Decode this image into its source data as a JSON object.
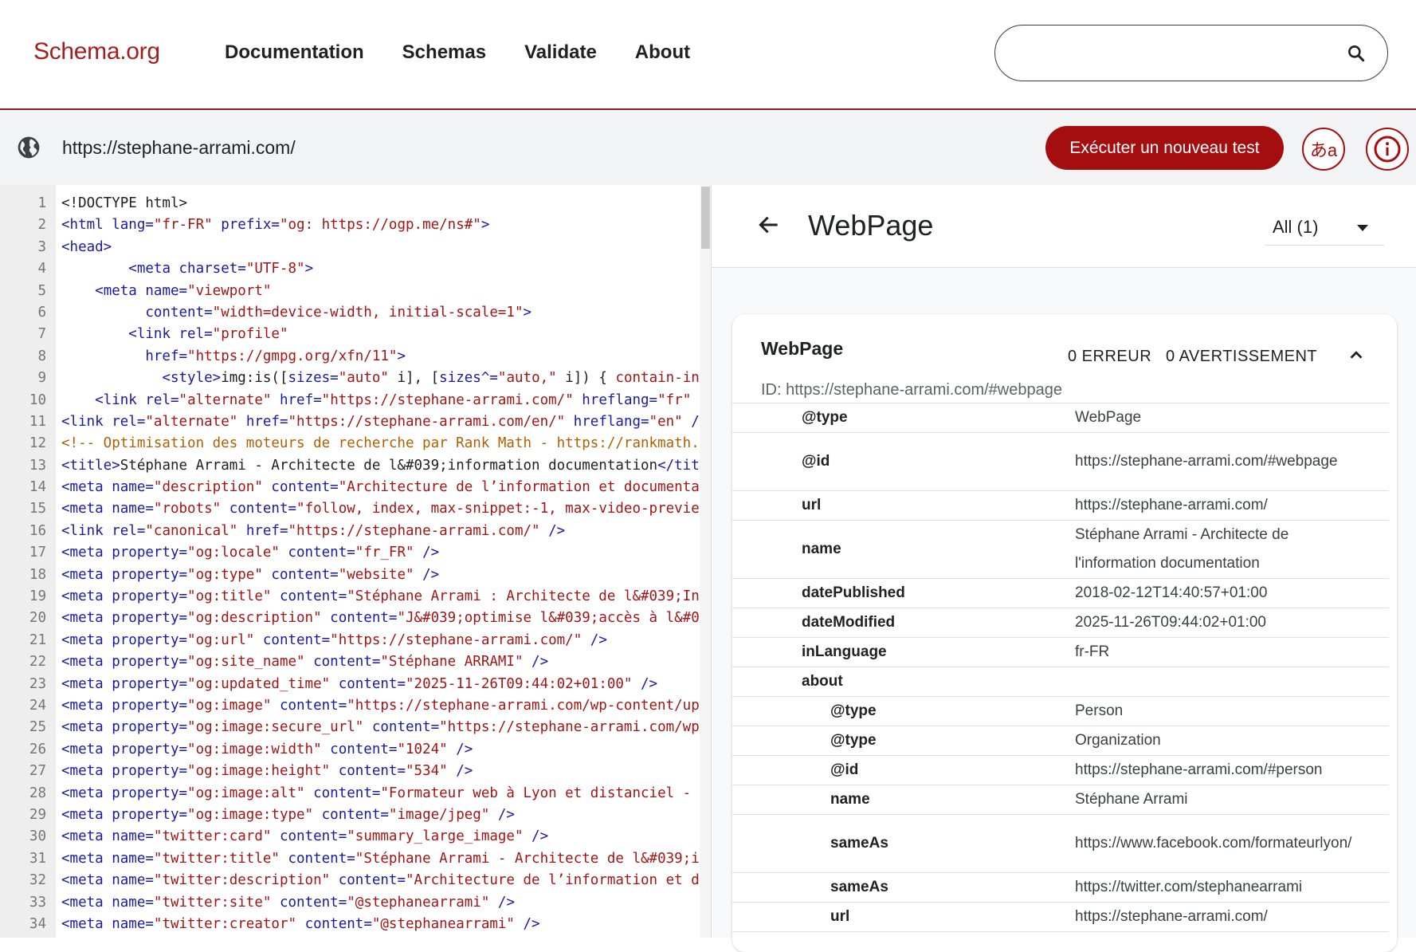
{
  "header": {
    "logo": "Schema.org",
    "nav": [
      "Documentation",
      "Schemas",
      "Validate",
      "About"
    ],
    "search_value": ""
  },
  "urlbar": {
    "url": "https://stephane-arrami.com/",
    "run_label": "Exécuter un nouveau test",
    "lang_label": "あa",
    "info_label": "i"
  },
  "code_lines": [
    [
      [
        "",
        "<!DOCTYPE html>"
      ]
    ],
    [
      [
        "t",
        "<html "
      ],
      [
        "a",
        "lang="
      ],
      [
        "v",
        "\"fr-FR\""
      ],
      [
        "a",
        " prefix="
      ],
      [
        "v",
        "\"og: https://ogp.me/ns#\""
      ],
      [
        "t",
        ">"
      ]
    ],
    [
      [
        "t",
        "<head>"
      ]
    ],
    [
      [
        "",
        "        "
      ],
      [
        "t",
        "<meta "
      ],
      [
        "a",
        "charset="
      ],
      [
        "v",
        "\"UTF-8\""
      ],
      [
        "t",
        ">"
      ]
    ],
    [
      [
        "",
        "    "
      ],
      [
        "t",
        "<meta "
      ],
      [
        "a",
        "name="
      ],
      [
        "v",
        "\"viewport\""
      ]
    ],
    [
      [
        "",
        "          "
      ],
      [
        "a",
        "content="
      ],
      [
        "v",
        "\"width=device-width, initial-scale=1\""
      ],
      [
        "t",
        ">"
      ]
    ],
    [
      [
        "",
        "        "
      ],
      [
        "t",
        "<link "
      ],
      [
        "a",
        "rel="
      ],
      [
        "v",
        "\"profile\""
      ]
    ],
    [
      [
        "",
        "          "
      ],
      [
        "a",
        "href="
      ],
      [
        "v",
        "\"https://gmpg.org/xfn/11\""
      ],
      [
        "t",
        ">"
      ]
    ],
    [
      [
        "",
        "            "
      ],
      [
        "t",
        "<style>"
      ],
      [
        "",
        "img:is(["
      ],
      [
        "a",
        "sizes="
      ],
      [
        "v",
        "\"auto\""
      ],
      [
        "",
        " i], ["
      ],
      [
        "a",
        "sizes^="
      ],
      [
        "v",
        "\"auto,\""
      ],
      [
        "",
        " i]) { "
      ],
      [
        "v",
        "contain-in"
      ]
    ],
    [
      [
        "",
        "    "
      ],
      [
        "t",
        "<link "
      ],
      [
        "a",
        "rel="
      ],
      [
        "v",
        "\"alternate\""
      ],
      [
        "a",
        " href="
      ],
      [
        "v",
        "\"https://stephane-arrami.com/\""
      ],
      [
        "a",
        " hreflang="
      ],
      [
        "v",
        "\"fr\""
      ]
    ],
    [
      [
        "t",
        "<link "
      ],
      [
        "a",
        "rel="
      ],
      [
        "v",
        "\"alternate\""
      ],
      [
        "a",
        " href="
      ],
      [
        "v",
        "\"https://stephane-arrami.com/en/\""
      ],
      [
        "a",
        " hreflang="
      ],
      [
        "v",
        "\"en\""
      ],
      [
        "t",
        " /"
      ]
    ],
    [
      [
        "c",
        "<!-- Optimisation des moteurs de recherche par Rank Math - https://rankmath."
      ]
    ],
    [
      [
        "t",
        "<title>"
      ],
      [
        "",
        "Stéphane Arrami - Architecte de l&#039;information documentation"
      ],
      [
        "t",
        "</tit"
      ]
    ],
    [
      [
        "t",
        "<meta "
      ],
      [
        "a",
        "name="
      ],
      [
        "v",
        "\"description\""
      ],
      [
        "a",
        " content="
      ],
      [
        "v",
        "\"Architecture de l’information et documenta"
      ]
    ],
    [
      [
        "t",
        "<meta "
      ],
      [
        "a",
        "name="
      ],
      [
        "v",
        "\"robots\""
      ],
      [
        "a",
        " content="
      ],
      [
        "v",
        "\"follow, index, max-snippet:-1, max-video-previe"
      ]
    ],
    [
      [
        "t",
        "<link "
      ],
      [
        "a",
        "rel="
      ],
      [
        "v",
        "\"canonical\""
      ],
      [
        "a",
        " href="
      ],
      [
        "v",
        "\"https://stephane-arrami.com/\""
      ],
      [
        "t",
        " />"
      ]
    ],
    [
      [
        "t",
        "<meta "
      ],
      [
        "a",
        "property="
      ],
      [
        "v",
        "\"og:locale\""
      ],
      [
        "a",
        " content="
      ],
      [
        "v",
        "\"fr_FR\""
      ],
      [
        "t",
        " />"
      ]
    ],
    [
      [
        "t",
        "<meta "
      ],
      [
        "a",
        "property="
      ],
      [
        "v",
        "\"og:type\""
      ],
      [
        "a",
        " content="
      ],
      [
        "v",
        "\"website\""
      ],
      [
        "t",
        " />"
      ]
    ],
    [
      [
        "t",
        "<meta "
      ],
      [
        "a",
        "property="
      ],
      [
        "v",
        "\"og:title\""
      ],
      [
        "a",
        " content="
      ],
      [
        "v",
        "\"Stéphane Arrami : Architecte de l&#039;In"
      ]
    ],
    [
      [
        "t",
        "<meta "
      ],
      [
        "a",
        "property="
      ],
      [
        "v",
        "\"og:description\""
      ],
      [
        "a",
        " content="
      ],
      [
        "v",
        "\"J&#039;optimise l&#039;accès à l&#0"
      ]
    ],
    [
      [
        "t",
        "<meta "
      ],
      [
        "a",
        "property="
      ],
      [
        "v",
        "\"og:url\""
      ],
      [
        "a",
        " content="
      ],
      [
        "v",
        "\"https://stephane-arrami.com/\""
      ],
      [
        "t",
        " />"
      ]
    ],
    [
      [
        "t",
        "<meta "
      ],
      [
        "a",
        "property="
      ],
      [
        "v",
        "\"og:site_name\""
      ],
      [
        "a",
        " content="
      ],
      [
        "v",
        "\"Stéphane ARRAMI\""
      ],
      [
        "t",
        " />"
      ]
    ],
    [
      [
        "t",
        "<meta "
      ],
      [
        "a",
        "property="
      ],
      [
        "v",
        "\"og:updated_time\""
      ],
      [
        "a",
        " content="
      ],
      [
        "v",
        "\"2025-11-26T09:44:02+01:00\""
      ],
      [
        "t",
        " />"
      ]
    ],
    [
      [
        "t",
        "<meta "
      ],
      [
        "a",
        "property="
      ],
      [
        "v",
        "\"og:image\""
      ],
      [
        "a",
        " content="
      ],
      [
        "v",
        "\"https://stephane-arrami.com/wp-content/up"
      ]
    ],
    [
      [
        "t",
        "<meta "
      ],
      [
        "a",
        "property="
      ],
      [
        "v",
        "\"og:image:secure_url\""
      ],
      [
        "a",
        " content="
      ],
      [
        "v",
        "\"https://stephane-arrami.com/wp"
      ]
    ],
    [
      [
        "t",
        "<meta "
      ],
      [
        "a",
        "property="
      ],
      [
        "v",
        "\"og:image:width\""
      ],
      [
        "a",
        " content="
      ],
      [
        "v",
        "\"1024\""
      ],
      [
        "t",
        " />"
      ]
    ],
    [
      [
        "t",
        "<meta "
      ],
      [
        "a",
        "property="
      ],
      [
        "v",
        "\"og:image:height\""
      ],
      [
        "a",
        " content="
      ],
      [
        "v",
        "\"534\""
      ],
      [
        "t",
        " />"
      ]
    ],
    [
      [
        "t",
        "<meta "
      ],
      [
        "a",
        "property="
      ],
      [
        "v",
        "\"og:image:alt\""
      ],
      [
        "a",
        " content="
      ],
      [
        "v",
        "\"Formateur web à Lyon et distanciel -"
      ]
    ],
    [
      [
        "t",
        "<meta "
      ],
      [
        "a",
        "property="
      ],
      [
        "v",
        "\"og:image:type\""
      ],
      [
        "a",
        " content="
      ],
      [
        "v",
        "\"image/jpeg\""
      ],
      [
        "t",
        " />"
      ]
    ],
    [
      [
        "t",
        "<meta "
      ],
      [
        "a",
        "name="
      ],
      [
        "v",
        "\"twitter:card\""
      ],
      [
        "a",
        " content="
      ],
      [
        "v",
        "\"summary_large_image\""
      ],
      [
        "t",
        " />"
      ]
    ],
    [
      [
        "t",
        "<meta "
      ],
      [
        "a",
        "name="
      ],
      [
        "v",
        "\"twitter:title\""
      ],
      [
        "a",
        " content="
      ],
      [
        "v",
        "\"Stéphane Arrami - Architecte de l&#039;i"
      ]
    ],
    [
      [
        "t",
        "<meta "
      ],
      [
        "a",
        "name="
      ],
      [
        "v",
        "\"twitter:description\""
      ],
      [
        "a",
        " content="
      ],
      [
        "v",
        "\"Architecture de l’information et d"
      ]
    ],
    [
      [
        "t",
        "<meta "
      ],
      [
        "a",
        "name="
      ],
      [
        "v",
        "\"twitter:site\""
      ],
      [
        "a",
        " content="
      ],
      [
        "v",
        "\"@stephanearrami\""
      ],
      [
        "t",
        " />"
      ]
    ],
    [
      [
        "t",
        "<meta "
      ],
      [
        "a",
        "name="
      ],
      [
        "v",
        "\"twitter:creator\""
      ],
      [
        "a",
        " content="
      ],
      [
        "v",
        "\"@stephanearrami\""
      ],
      [
        "t",
        " />"
      ]
    ]
  ],
  "panel": {
    "title": "WebPage",
    "filter": "All (1)",
    "card": {
      "title": "WebPage",
      "errors": "0 ERREUR",
      "warnings": "0 AVERTISSEMENT",
      "id": "ID: https://stephane-arrami.com/#webpage",
      "rows": [
        {
          "key": "@type",
          "value": "WebPage",
          "level": 0,
          "tall": false
        },
        {
          "key": "@id",
          "value": "https://stephane-arrami.com/#webpage",
          "level": 0,
          "tall": true
        },
        {
          "key": "url",
          "value": "https://stephane-arrami.com/",
          "level": 0,
          "tall": false
        },
        {
          "key": "name",
          "value": "Stéphane Arrami - Architecte de l'information documentation",
          "level": 0,
          "tall": true
        },
        {
          "key": "datePublished",
          "value": "2018-02-12T14:40:57+01:00",
          "level": 0,
          "tall": false
        },
        {
          "key": "dateModified",
          "value": "2025-11-26T09:44:02+01:00",
          "level": 0,
          "tall": false
        },
        {
          "key": "inLanguage",
          "value": "fr-FR",
          "level": 0,
          "tall": false
        },
        {
          "key": "about",
          "value": "",
          "level": 0,
          "tall": false
        },
        {
          "key": "@type",
          "value": "Person",
          "level": 1,
          "tall": false
        },
        {
          "key": "@type",
          "value": "Organization",
          "level": 1,
          "tall": false
        },
        {
          "key": "@id",
          "value": "https://stephane-arrami.com/#person",
          "level": 1,
          "tall": false
        },
        {
          "key": "name",
          "value": "Stéphane Arrami",
          "level": 1,
          "tall": false
        },
        {
          "key": "sameAs",
          "value": "https://www.facebook.com/formateurlyon/",
          "level": 1,
          "tall": true
        },
        {
          "key": "sameAs",
          "value": "https://twitter.com/stephanearrami",
          "level": 1,
          "tall": false
        },
        {
          "key": "url",
          "value": "https://stephane-arrami.com/",
          "level": 1,
          "tall": false
        }
      ]
    }
  },
  "icons": {
    "search": "search-icon",
    "globe": "globe-icon",
    "back": "arrow-back-icon",
    "collapse": "chevron-up-icon",
    "dropdown": "caret-down-icon"
  },
  "colors": {
    "brand": "#a11f1f",
    "button": "#a50e0e",
    "tag": "#1a1aa6",
    "value": "#a31515",
    "comment": "#b06000"
  }
}
